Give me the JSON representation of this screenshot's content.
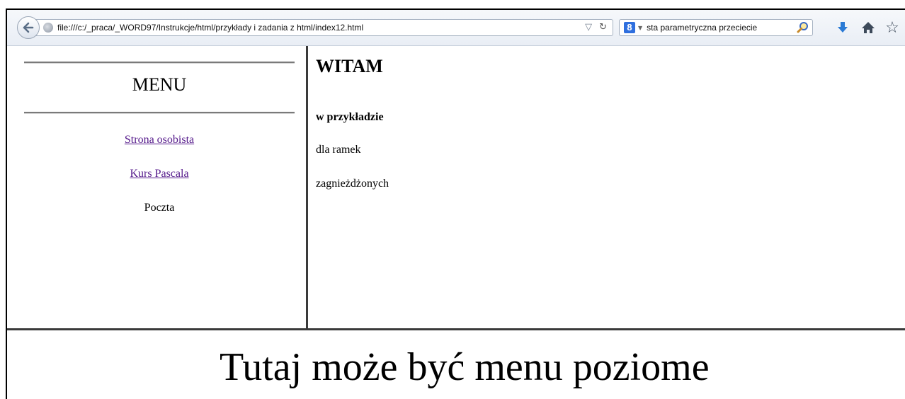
{
  "browser": {
    "url": "file:///c:/_praca/_WORD97/Instrukcje/html/przykłady i zadania z html/index12.html",
    "search_query": "sta parametryczna przeciecie"
  },
  "menu_frame": {
    "title": "MENU",
    "links": [
      {
        "label": "Strona osobista",
        "is_link": true
      },
      {
        "label": "Kurs Pascala",
        "is_link": true
      },
      {
        "label": "Poczta",
        "is_link": false
      }
    ]
  },
  "main_frame": {
    "heading": "WITAM",
    "bold_line": "w przykładzie",
    "line1": "dla ramek",
    "line2": "zagnieżdżonych"
  },
  "bottom_frame": {
    "text": "Tutaj może być menu poziome"
  },
  "colors": {
    "visited_link": "#551a8b",
    "frame_border": "#3a3a3a",
    "google_blue": "#2f6fde",
    "download_blue": "#2a7ad5"
  }
}
